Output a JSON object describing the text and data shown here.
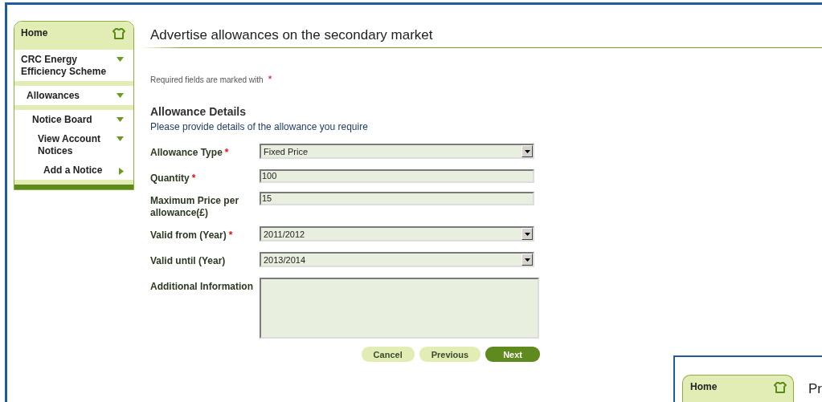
{
  "nav": [
    {
      "label": "Home",
      "kind": "home",
      "children": [
        {
          "label": "CRC Energy Efficiency Scheme",
          "kind": "item",
          "expanded": true,
          "children": [
            {
              "label": "Allowances",
              "kind": "item",
              "expanded": true,
              "children": [
                {
                  "label": "Notice Board",
                  "kind": "item",
                  "expanded": true,
                  "children": [
                    {
                      "label": "View Account Notices",
                      "kind": "item",
                      "expanded": true,
                      "children": [
                        {
                          "label": "Add a Notice",
                          "kind": "item",
                          "expanded": false
                        }
                      ]
                    }
                  ]
                }
              ]
            }
          ]
        }
      ]
    }
  ],
  "page": {
    "title": "Advertise allowances on the secondary market",
    "required_note": "Required fields are marked with",
    "required_mark": "*"
  },
  "section": {
    "title": "Allowance Details",
    "subtitle": "Please provide details of the allowance you require"
  },
  "fields": [
    {
      "label": "Allowance Type",
      "kind": "select",
      "required": true,
      "value": "Fixed Price"
    },
    {
      "label": "Quantity",
      "kind": "text",
      "required": true,
      "value": "100"
    },
    {
      "label": "Maximum Price per allowance(£)",
      "kind": "text",
      "required": false,
      "value": "15"
    },
    {
      "label": "Valid from (Year)",
      "kind": "select",
      "required": true,
      "value": "2011/2012"
    },
    {
      "label": "Valid until (Year)",
      "kind": "select",
      "required": false,
      "value": "2013/2014"
    },
    {
      "label": "Additional Information",
      "kind": "textarea",
      "required": false
    }
  ],
  "buttons": [
    {
      "label": "Cancel",
      "kind": "secondary"
    },
    {
      "label": "Previous",
      "kind": "secondary"
    },
    {
      "label": "Next",
      "kind": "primary"
    }
  ],
  "inset": {
    "nav_home": "Home",
    "title": "Pr"
  }
}
